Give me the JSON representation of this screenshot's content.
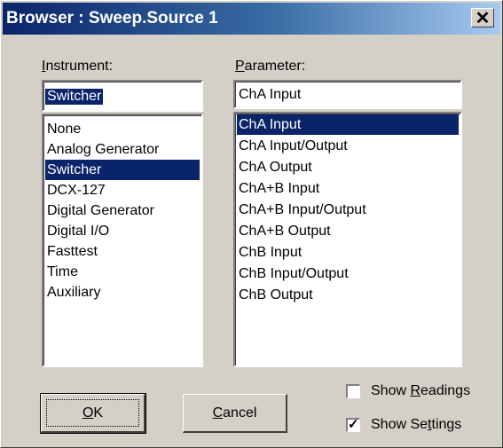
{
  "window": {
    "title": "Browser : Sweep.Source 1",
    "close_glyph": "✕"
  },
  "instrument": {
    "label_hotkey": "I",
    "label_rest": "nstrument:",
    "value": "Switcher",
    "items": [
      {
        "label": "None",
        "selected": false
      },
      {
        "label": "Analog Generator",
        "selected": false
      },
      {
        "label": "Switcher",
        "selected": true
      },
      {
        "label": "DCX-127",
        "selected": false
      },
      {
        "label": "Digital Generator",
        "selected": false
      },
      {
        "label": "Digital I/O",
        "selected": false
      },
      {
        "label": "Fasttest",
        "selected": false
      },
      {
        "label": "Time",
        "selected": false
      },
      {
        "label": "Auxiliary",
        "selected": false
      }
    ]
  },
  "parameter": {
    "label_hotkey": "P",
    "label_rest": "arameter:",
    "value": "ChA Input",
    "items": [
      {
        "label": "ChA Input",
        "selected": true
      },
      {
        "label": "ChA Input/Output",
        "selected": false
      },
      {
        "label": "ChA Output",
        "selected": false
      },
      {
        "label": "ChA+B Input",
        "selected": false
      },
      {
        "label": "ChA+B Input/Output",
        "selected": false
      },
      {
        "label": "ChA+B Output",
        "selected": false
      },
      {
        "label": "ChB Input",
        "selected": false
      },
      {
        "label": "ChB Input/Output",
        "selected": false
      },
      {
        "label": "ChB Output",
        "selected": false
      }
    ]
  },
  "buttons": {
    "ok_hotkey": "O",
    "ok_rest": "K",
    "cancel_hotkey": "C",
    "cancel_rest": "ancel"
  },
  "checkboxes": {
    "readings_pre": "Show ",
    "readings_hotkey": "R",
    "readings_rest": "eadings",
    "readings_checked": false,
    "settings_pre": "Show Se",
    "settings_hotkey": "t",
    "settings_rest": "tings",
    "settings_checked": true,
    "check_glyph": "✓"
  },
  "colors": {
    "selection": "#0a246a",
    "face": "#d4d0c8"
  }
}
